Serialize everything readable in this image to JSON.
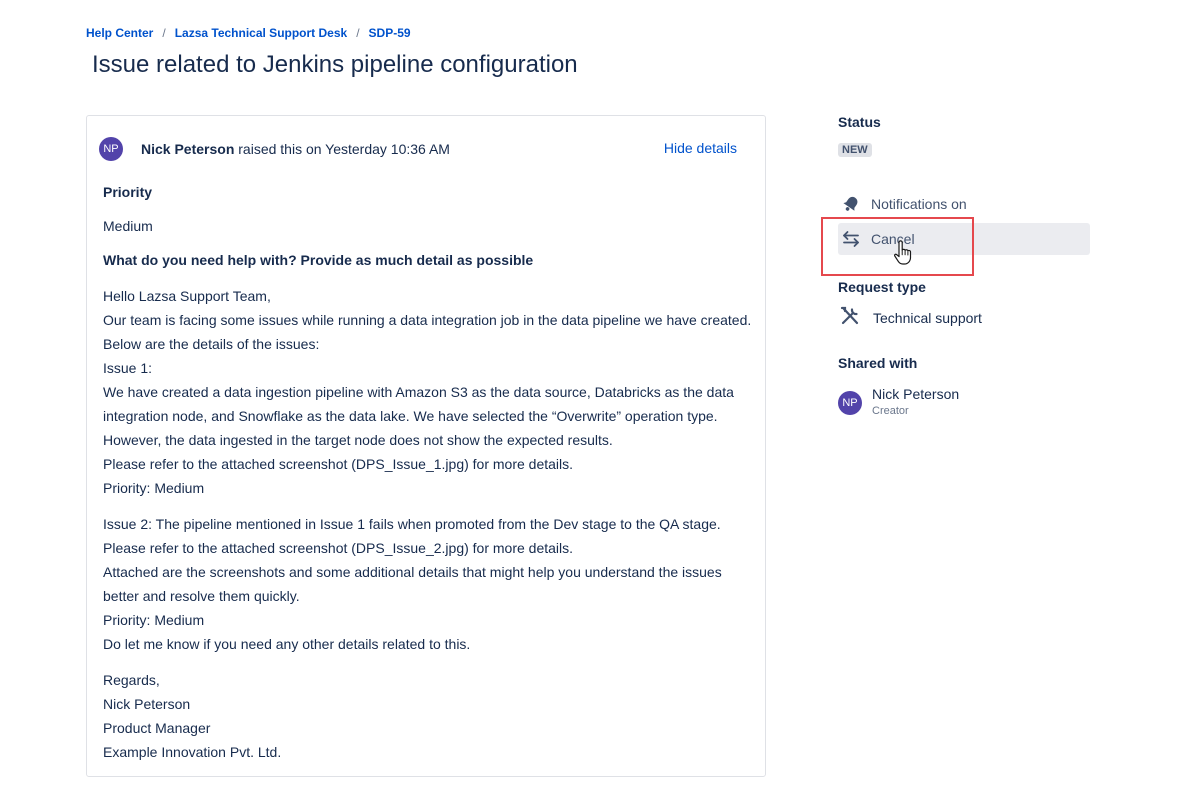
{
  "breadcrumb": {
    "help_center": "Help Center",
    "desk": "Lazsa Technical Support Desk",
    "issue_key": "SDP-59",
    "separator": "/"
  },
  "page_title": "Issue related to Jenkins pipeline configuration",
  "request": {
    "avatar_initials": "NP",
    "author": "Nick Peterson",
    "raised_text": " raised this on Yesterday 10:36 AM",
    "hide_details": "Hide details",
    "priority_label": "Priority",
    "priority_value": "Medium",
    "help_label": "What do you need help with? Provide as much detail as possible",
    "paragraph1": [
      "Hello Lazsa Support Team,",
      "Our team is facing some issues while running a data integration job in the data pipeline we have created.",
      "Below are the details of the issues:",
      "Issue 1:",
      "We have created a data ingestion pipeline with Amazon S3 as the data source, Databricks as the data",
      "integration node, and Snowflake as the data lake. We have selected the “Overwrite” operation type.",
      "However, the data ingested in the target node does not show the expected results.",
      "Please refer to the attached screenshot (DPS_Issue_1.jpg) for more details.",
      "Priority: Medium"
    ],
    "paragraph2": [
      "Issue 2: The pipeline mentioned in Issue 1 fails when promoted from the Dev stage to the QA stage.",
      "Please refer to the attached screenshot (DPS_Issue_2.jpg) for more details.",
      "Attached are the screenshots and some additional details that might help you understand the issues",
      "better and resolve them quickly.",
      "Priority: Medium",
      "Do let me know if you need any other details related to this."
    ],
    "paragraph3": [
      "Regards,",
      "Nick Peterson",
      "Product Manager",
      "Example Innovation Pvt. Ltd."
    ]
  },
  "sidebar": {
    "status_heading": "Status",
    "status_value": "NEW",
    "notifications_label": "Notifications on",
    "cancel_label": "Cancel",
    "request_type_heading": "Request type",
    "request_type_value": "Technical support",
    "shared_with_heading": "Shared with",
    "shared_person": {
      "initials": "NP",
      "name": "Nick Peterson",
      "role": "Creator"
    }
  },
  "icons": {
    "notifications": "bell-icon",
    "cancel": "swap-arrows-icon",
    "request_type": "tools-icon",
    "cursor": "hand-pointer-icon"
  },
  "colors": {
    "link": "#0052cc",
    "avatar": "#5243aa",
    "highlight_border": "#e5484d",
    "hover_bg": "#ebecf0"
  }
}
